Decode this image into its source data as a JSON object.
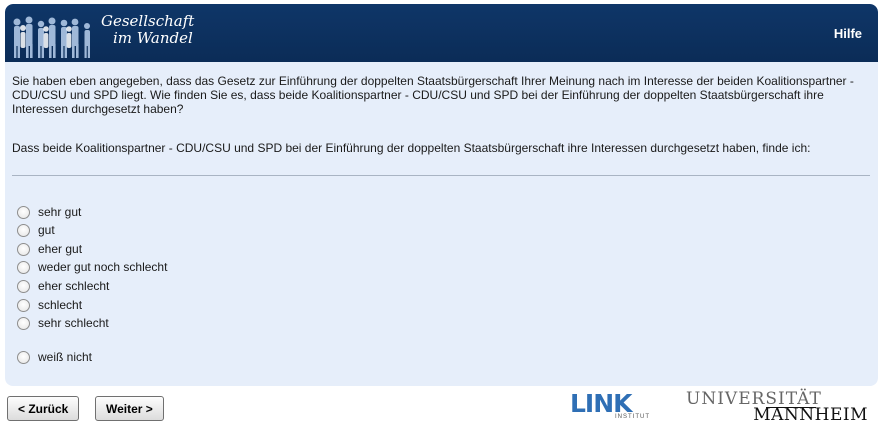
{
  "header": {
    "logo_line1": "Gesellschaft",
    "logo_line2": "im Wandel",
    "help_label": "Hilfe"
  },
  "question": {
    "intro": "Sie haben eben angegeben, dass das Gesetz zur Einführung der doppelten Staatsbürgerschaft Ihrer Meinung nach im Interesse der beiden Koalitionspartner - CDU/CSU und SPD liegt. Wie finden Sie es, dass beide Koalitionspartner - CDU/CSU und SPD bei der Einführung der doppelten Staatsbürgerschaft ihre Interessen durchgesetzt haben?",
    "prompt": "Dass beide Koalitionspartner - CDU/CSU und SPD bei der Einführung der doppelten Staatsbürgerschaft ihre Interessen durchgesetzt haben, finde ich:"
  },
  "options": [
    "sehr gut",
    "gut",
    "eher gut",
    "weder gut noch schlecht",
    "eher schlecht",
    "schlecht",
    "sehr schlecht",
    "weiß nicht"
  ],
  "nav": {
    "back_label": "< Zurück",
    "next_label": "Weiter >"
  },
  "footer": {
    "link_logo": "LINK",
    "link_sub": "INSTITUT",
    "uni_line1": "UNIVERSITÄT",
    "uni_line2": "MANNHEIM"
  },
  "colors": {
    "header_bg": "#0f3668",
    "panel_bg": "#e6eefa",
    "link_blue": "#2f6fb5"
  }
}
